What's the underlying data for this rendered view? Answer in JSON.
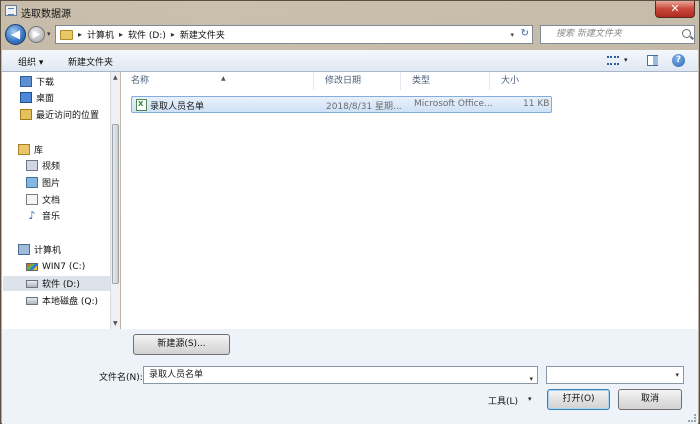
{
  "window": {
    "title": "选取数据源",
    "close_label": "✕"
  },
  "address": {
    "crumbs": [
      "计算机",
      "软件 (D:)",
      "新建文件夹"
    ],
    "search_placeholder": "搜索 新建文件夹"
  },
  "toolbar": {
    "organize_label": "组织 ▾",
    "new_folder_label": "新建文件夹"
  },
  "nav": {
    "items": [
      {
        "label": "下载",
        "icon": "download-icon"
      },
      {
        "label": "桌面",
        "icon": "desktop-icon"
      },
      {
        "label": "最近访问的位置",
        "icon": "recent-places-icon"
      },
      {
        "label": "库",
        "icon": "library-icon"
      },
      {
        "label": "视频",
        "icon": "video-icon"
      },
      {
        "label": "图片",
        "icon": "pictures-icon"
      },
      {
        "label": "文档",
        "icon": "documents-icon"
      },
      {
        "label": "音乐",
        "icon": "music-icon"
      },
      {
        "label": "计算机",
        "icon": "computer-icon"
      },
      {
        "label": "WIN7 (C:)",
        "icon": "windows-drive-icon"
      },
      {
        "label": "软件 (D:)",
        "icon": "drive-icon"
      },
      {
        "label": "本地磁盘 (Q:)",
        "icon": "drive-icon"
      }
    ]
  },
  "files": {
    "columns": [
      "名称",
      "修改日期",
      "类型",
      "大小"
    ],
    "rows": [
      {
        "name": "录取人员名单",
        "modified": "2018/8/31 星期...",
        "type": "Microsoft Office...",
        "size": "11 KB"
      }
    ]
  },
  "bottom": {
    "new_source_label": "新建源(S)...",
    "filename_label": "文件名(N):",
    "filename_value": "录取人员名单",
    "tools_label": "工具(L)",
    "open_label": "打开(O)",
    "cancel_label": "取消"
  }
}
